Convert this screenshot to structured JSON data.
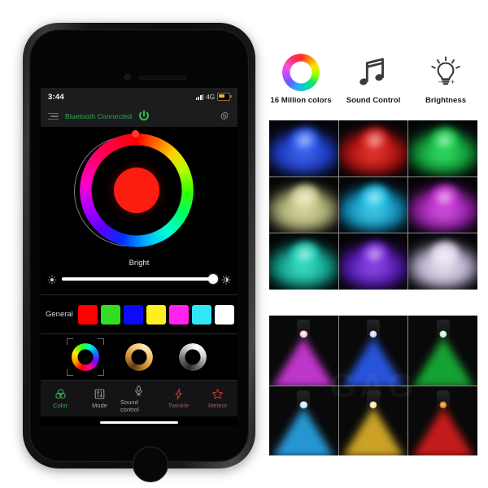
{
  "phone": {
    "status_bar": {
      "time": "3:44",
      "network": "4G",
      "signal_icon": "signal-bars-icon",
      "battery_icon": "battery-low-power-icon"
    },
    "app_bar": {
      "menu_icon": "hamburger-menu-icon",
      "connection_status": "Bluetooth Connected",
      "power_icon": "power-button-icon",
      "settings_icon": "gear-icon",
      "status_color": "#2fa84f"
    },
    "color_wheel": {
      "selected_color": "#fc1d10",
      "handle_color": "#ff3b30",
      "handle_angle_deg": 0
    },
    "brightness": {
      "label": "Bright",
      "value_percent": 100,
      "low_icon": "brightness-low-icon",
      "high_icon": "brightness-high-icon"
    },
    "general_palette": {
      "label": "General",
      "swatches": [
        {
          "name": "red",
          "hex": "#ff0000"
        },
        {
          "name": "green",
          "hex": "#33dd22"
        },
        {
          "name": "blue",
          "hex": "#0b0bf5"
        },
        {
          "name": "yellow",
          "hex": "#ffee22"
        },
        {
          "name": "magenta",
          "hex": "#ff22ee"
        },
        {
          "name": "cyan",
          "hex": "#33e6f5"
        },
        {
          "name": "white",
          "hex": "#ffffff"
        }
      ]
    },
    "mode_rings": [
      {
        "name": "rgb-cycle-ring",
        "selected": true
      },
      {
        "name": "warm-white-ring",
        "selected": false
      },
      {
        "name": "cool-white-ring",
        "selected": false
      }
    ],
    "tabs": [
      {
        "label": "Color",
        "icon": "color-circles-icon",
        "state": "active"
      },
      {
        "label": "Mode",
        "icon": "sliders-icon",
        "state": "inactive"
      },
      {
        "label": "Sound control",
        "icon": "microphone-icon",
        "state": "inactive"
      },
      {
        "label": "Twinkle",
        "icon": "lightning-bolt-icon",
        "state": "accent"
      },
      {
        "label": "Meteor",
        "icon": "star-icon",
        "state": "accent"
      }
    ],
    "active_tab_color": "#3fae57",
    "accent_tab_color": "#9c5f5f"
  },
  "features": [
    {
      "label": "16 Million colors",
      "icon": "color-wheel-icon"
    },
    {
      "label": "Sound Control",
      "icon": "music-note-icon"
    },
    {
      "label": "Brightness",
      "icon": "light-bulb-icon"
    }
  ],
  "fiber_grid": {
    "rows": 3,
    "cols": 3,
    "cells": [
      {
        "color": "#1f5bff"
      },
      {
        "color": "#e01010"
      },
      {
        "color": "#14d04a"
      },
      {
        "color": "#d8d89a"
      },
      {
        "color": "#19c8f0"
      },
      {
        "color": "#c82fd8"
      },
      {
        "color": "#1ad8c0"
      },
      {
        "color": "#7a2adf"
      },
      {
        "color": "#e8dff5"
      }
    ]
  },
  "spotlight_grid": {
    "rows": 2,
    "cols": 3,
    "watermark": "GAG",
    "cells": [
      {
        "color": "#d23be0"
      },
      {
        "color": "#2a5cf0"
      },
      {
        "color": "#17b238"
      },
      {
        "color": "#2aa6e8"
      },
      {
        "color": "#e0b22a"
      },
      {
        "color": "#d81d1d"
      }
    ]
  }
}
